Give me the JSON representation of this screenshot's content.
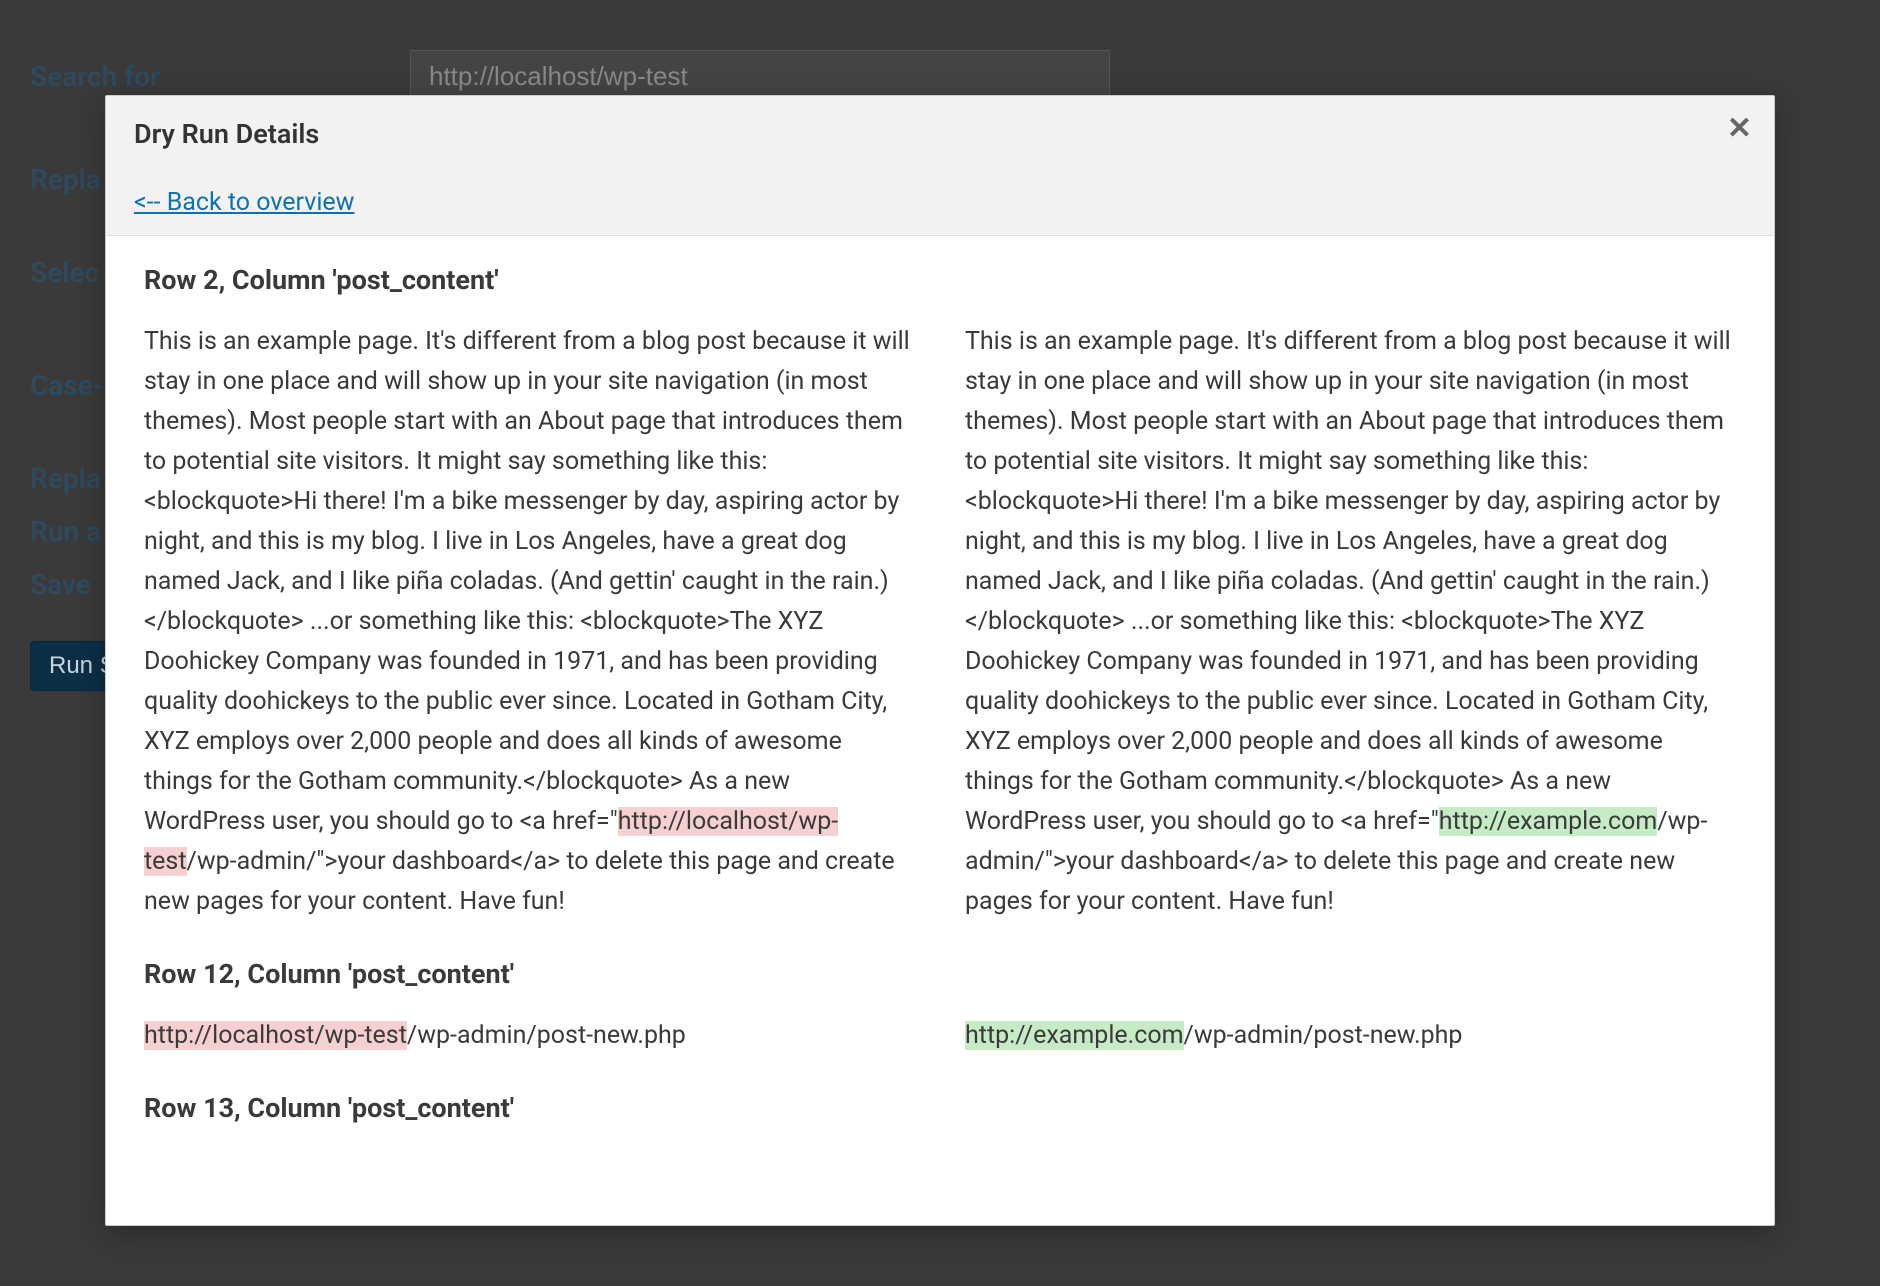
{
  "background_form": {
    "search_label": "Search for",
    "search_value": "http://localhost/wp-test",
    "replace_label_partial": "Repla",
    "select_label_partial": "Selec",
    "case_label_partial": "Case-",
    "replace2_label_partial": "Repla",
    "run_label_partial": "Run a",
    "save_label_partial": "Save",
    "run_button_partial": "Run S"
  },
  "modal": {
    "title": "Dry Run Details",
    "back_link": "<-- Back to overview"
  },
  "rows": [
    {
      "heading": "Row 2, Column 'post_content'",
      "before": {
        "pre": "This is an example page. It's different from a blog post because it will stay in one place and will show up in your site navigation (in most themes). Most people start with an About page that introduces them to potential site visitors. It might say something like this: <blockquote>Hi there! I'm a bike messenger by day, aspiring actor by night, and this is my blog. I live in Los Angeles, have a great dog named Jack, and I like piña coladas. (And gettin' caught in the rain.)</blockquote> ...or something like this: <blockquote>The XYZ Doohickey Company was founded in 1971, and has been providing quality doohickeys to the public ever since. Located in Gotham City, XYZ employs over 2,000 people and does all kinds of awesome things for the Gotham community.</blockquote> As a new WordPress user, you should go to <a href=\"",
        "hl": "http://localhost/wp-test",
        "post": "/wp-admin/\">your dashboard</a> to delete this page and create new pages for your content. Have fun!"
      },
      "after": {
        "pre": "This is an example page. It's different from a blog post because it will stay in one place and will show up in your site navigation (in most themes). Most people start with an About page that introduces them to potential site visitors. It might say something like this: <blockquote>Hi there! I'm a bike messenger by day, aspiring actor by night, and this is my blog. I live in Los Angeles, have a great dog named Jack, and I like piña coladas. (And gettin' caught in the rain.)</blockquote> ...or something like this: <blockquote>The XYZ Doohickey Company was founded in 1971, and has been providing quality doohickeys to the public ever since. Located in Gotham City, XYZ employs over 2,000 people and does all kinds of awesome things for the Gotham community.</blockquote> As a new WordPress user, you should go to <a href=\"",
        "hl": "http://example.com",
        "post": "/wp-admin/\">your dashboard</a> to delete this page and create new pages for your content. Have fun!"
      }
    },
    {
      "heading": "Row 12, Column 'post_content'",
      "before": {
        "pre": "",
        "hl": "http://localhost/wp-test",
        "post": "/wp-admin/post-new.php"
      },
      "after": {
        "pre": "",
        "hl": "http://example.com",
        "post": "/wp-admin/post-new.php"
      }
    },
    {
      "heading": "Row 13, Column 'post_content'",
      "before": {
        "pre": "",
        "hl": "",
        "post": ""
      },
      "after": {
        "pre": "",
        "hl": "",
        "post": ""
      }
    }
  ]
}
